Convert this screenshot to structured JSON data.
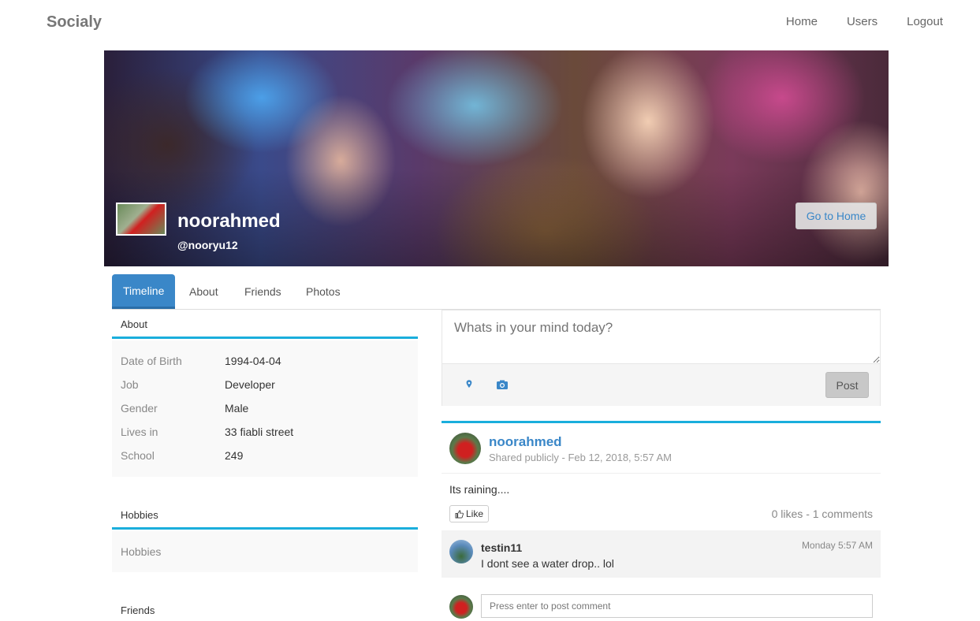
{
  "navbar": {
    "brand": "Socialy",
    "links": [
      "Home",
      "Users",
      "Logout"
    ]
  },
  "cover": {
    "name": "noorahmed",
    "handle": "@nooryu12",
    "go_home_label": "Go to Home"
  },
  "tabs": [
    "Timeline",
    "About",
    "Friends",
    "Photos"
  ],
  "about": {
    "title": "About",
    "rows": [
      {
        "label": "Date of Birth",
        "value": "1994-04-04"
      },
      {
        "label": "Job",
        "value": "Developer"
      },
      {
        "label": "Gender",
        "value": "Male"
      },
      {
        "label": "Lives in",
        "value": "33 fiabli street"
      },
      {
        "label": "School",
        "value": "249"
      }
    ]
  },
  "hobbies": {
    "title": "Hobbies",
    "body": "Hobbies"
  },
  "friends": {
    "title": "Friends"
  },
  "composer": {
    "placeholder": "Whats in your mind today?",
    "post_label": "Post",
    "icons": [
      "map-marker-icon",
      "camera-icon"
    ]
  },
  "post": {
    "author": "noorahmed",
    "meta": "Shared publicly - Feb 12, 2018, 5:57 AM",
    "text": "Its raining....",
    "like_label": "Like",
    "stats": "0 likes - 1 comments",
    "comments": [
      {
        "user": "testin11",
        "time": "Monday 5:57 AM",
        "text": "I dont see a water drop.. lol"
      }
    ],
    "reply_placeholder": "Press enter to post comment"
  },
  "colors": {
    "accent": "#3a87c8",
    "panel_border": "#1aaedc"
  }
}
